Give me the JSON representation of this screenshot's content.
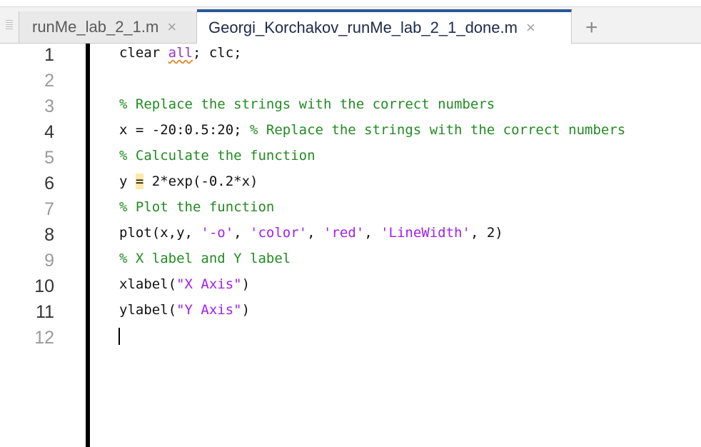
{
  "tabs": [
    {
      "label": "runMe_lab_2_1.m",
      "active": false
    },
    {
      "label": "Georgi_Korchakov_runMe_lab_2_1_done.m",
      "active": true
    }
  ],
  "tab_close_glyph": "×",
  "new_tab_glyph": "+",
  "line_numbers": [
    "1",
    "2",
    "3",
    "4",
    "5",
    "6",
    "7",
    "8",
    "9",
    "10",
    "11",
    "12"
  ],
  "code": {
    "l1_a": "clear ",
    "l1_kw": "all",
    "l1_b": "; clc;",
    "l3": "% Replace the strings with the correct numbers",
    "l4_a": "x = -20:0.5:20; ",
    "l4_cm": "% Replace the strings with the correct numbers",
    "l5": "% Calculate the function",
    "l6_a": "y ",
    "l6_eq": "=",
    "l6_b": " 2*exp(-0.2*x)",
    "l7": "% Plot the function",
    "l8_a": "plot(x,y, ",
    "l8_s1": "'-o'",
    "l8_c1": ", ",
    "l8_s2": "'color'",
    "l8_c2": ", ",
    "l8_s3": "'red'",
    "l8_c3": ", ",
    "l8_s4": "'LineWidth'",
    "l8_b": ", 2)",
    "l9": "% X label and Y label",
    "l10_a": "xlabel(",
    "l10_s": "\"X Axis\"",
    "l10_b": ")",
    "l11_a": "ylabel(",
    "l11_s": "\"Y Axis\"",
    "l11_b": ")"
  },
  "colors": {
    "comment": "#228b22",
    "string": "#a020f0",
    "accent": "#2b5797"
  }
}
